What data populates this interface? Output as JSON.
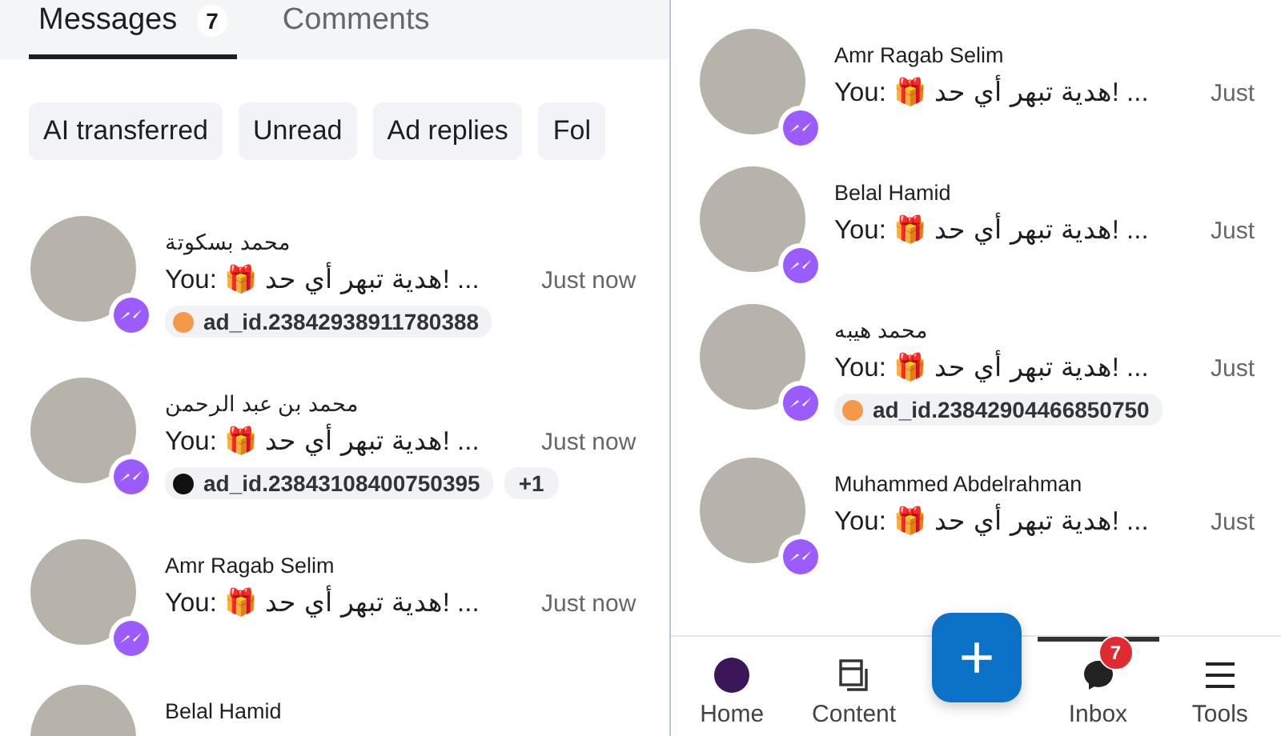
{
  "left": {
    "tabs": [
      {
        "label": "Messages",
        "count": "7",
        "selected": true
      },
      {
        "label": "Comments",
        "selected": false
      }
    ],
    "filters": [
      {
        "label": "AI transferred"
      },
      {
        "label": "Unread"
      },
      {
        "label": "Ad replies"
      },
      {
        "label": "Fol"
      }
    ],
    "conversations": [
      {
        "name": "محمد بسكوتة",
        "preview": "You: 🎁 هدية تبهر أي حد! ...",
        "time": "Just now",
        "tags": [
          {
            "label": "ad_id.23842938911780388",
            "color": "#f4994a"
          }
        ]
      },
      {
        "name": "محمد بن عبد الرحمن",
        "preview": "You: 🎁 هدية تبهر أي حد! ...",
        "time": "Just now",
        "tags": [
          {
            "label": "ad_id.23843108400750395",
            "color": "#111111"
          }
        ],
        "more": "+1"
      },
      {
        "name": "Amr Ragab Selim",
        "preview": "You: 🎁 هدية تبهر أي حد! ...",
        "time": "Just now"
      },
      {
        "name": "Belal Hamid"
      }
    ]
  },
  "right": {
    "conversations": [
      {
        "name": "Amr Ragab Selim",
        "preview": "You: 🎁 هدية تبهر أي حد! ...",
        "time": "Just"
      },
      {
        "name": "Belal Hamid",
        "preview": "You: 🎁 هدية تبهر أي حد! ...",
        "time": "Just"
      },
      {
        "name": "محمد هيبه",
        "preview": "You: 🎁 هدية تبهر أي حد! ...",
        "time": "Just",
        "tags": [
          {
            "label": "ad_id.23842904466850750",
            "color": "#f4994a"
          }
        ]
      },
      {
        "name": "Muhammed Abdelrahman",
        "preview": "You: 🎁 هدية تبهر أي حد! ...",
        "time": "Just"
      }
    ],
    "nav": [
      {
        "kind": "home",
        "label": "Home",
        "selected": false
      },
      {
        "kind": "content",
        "label": "Content",
        "selected": false
      },
      {
        "kind": "create",
        "selected": false
      },
      {
        "kind": "inbox",
        "label": "Inbox",
        "badge": "7",
        "selected": true
      },
      {
        "kind": "tools",
        "label": "Tools",
        "selected": false
      }
    ]
  }
}
